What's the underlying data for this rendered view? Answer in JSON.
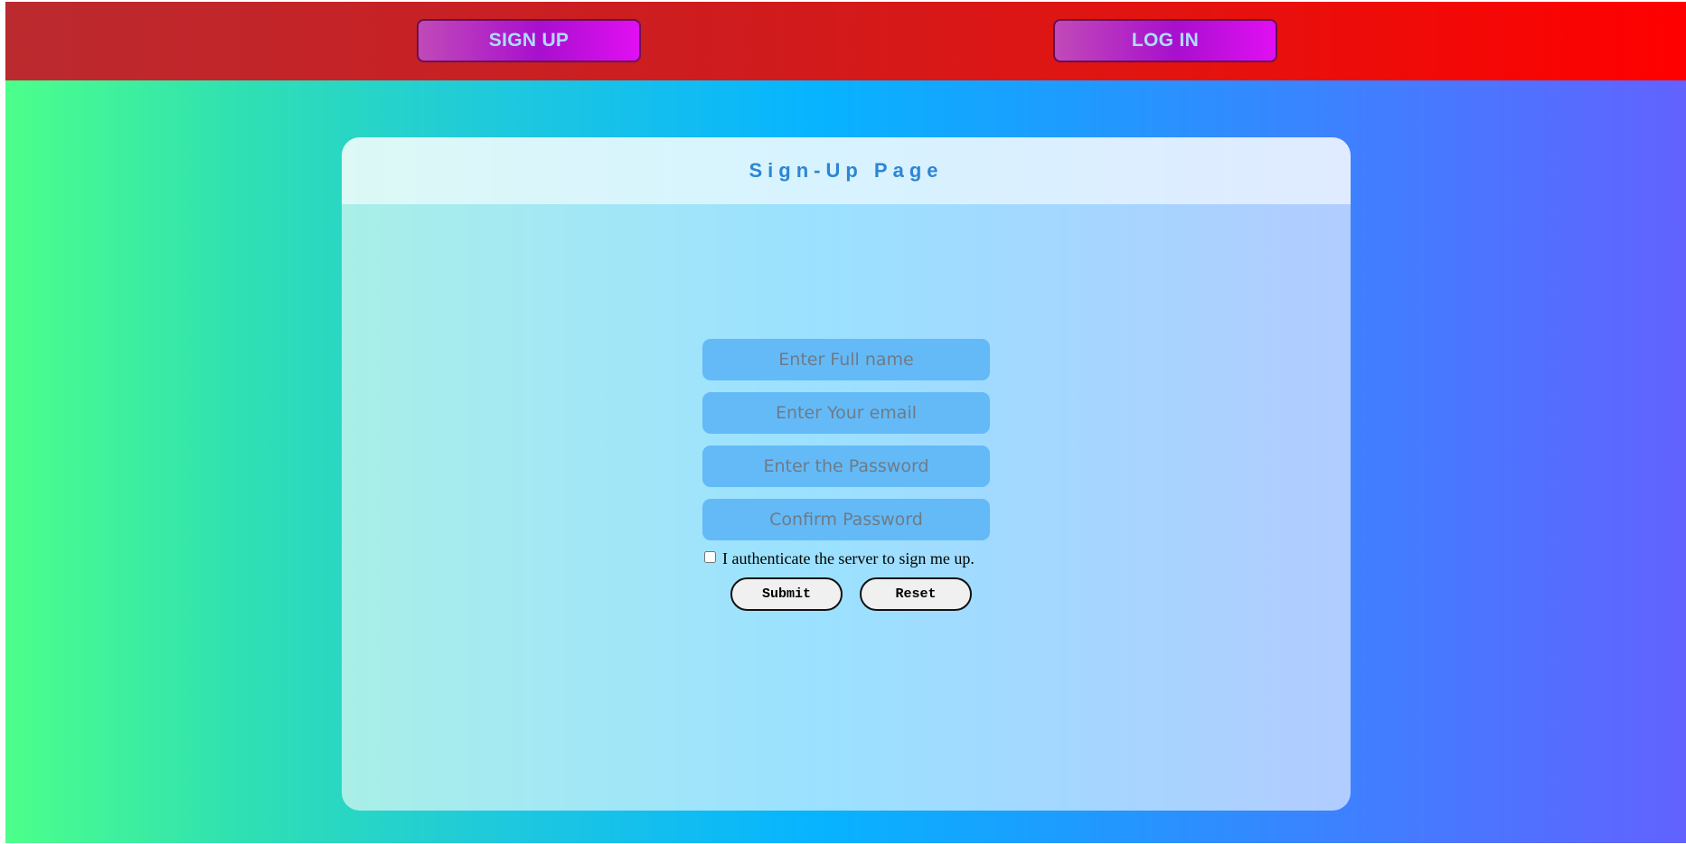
{
  "nav": {
    "signup_label": "SIGN UP",
    "login_label": "LOG IN"
  },
  "form": {
    "title": "Sign-Up Page",
    "fullname_placeholder": "Enter Full name",
    "email_placeholder": "Enter Your email",
    "password_placeholder": "Enter the Password",
    "confirm_placeholder": "Confirm Password",
    "consent_label": "I authenticate the server to sign me up.",
    "consent_checked": false,
    "submit_label": "Submit",
    "reset_label": "Reset"
  },
  "colors": {
    "topbar_start": "#bb2a2f",
    "topbar_end": "#ff0000",
    "nav_button": "#a80fce",
    "nav_button_text": "#aedcff",
    "background_start": "#4cff8a",
    "background_mid": "#07b4ff",
    "background_end": "#6262ff",
    "title_text": "#2d86d2",
    "input_fill": "#64baf7"
  }
}
